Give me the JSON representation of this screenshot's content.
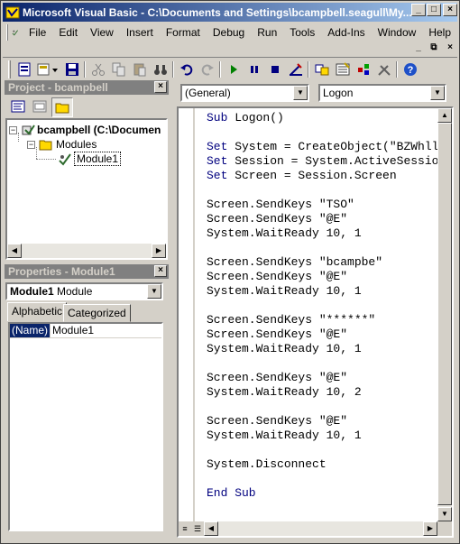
{
  "window": {
    "title": "Microsoft Visual Basic - C:\\Documents and Settings\\bcampbell.seagull\\My..."
  },
  "menu": {
    "items": [
      {
        "label": "File"
      },
      {
        "label": "Edit"
      },
      {
        "label": "View"
      },
      {
        "label": "Insert"
      },
      {
        "label": "Format"
      },
      {
        "label": "Debug"
      },
      {
        "label": "Run"
      },
      {
        "label": "Tools"
      },
      {
        "label": "Add-Ins"
      },
      {
        "label": "Window"
      },
      {
        "label": "Help"
      }
    ]
  },
  "project_panel": {
    "title": "Project - bcampbell",
    "root": "bcampbell (C:\\Documen",
    "folder": "Modules",
    "module": "Module1"
  },
  "properties_panel": {
    "title": "Properties - Module1",
    "object_bold": "Module1",
    "object_type": "Module",
    "tabs": [
      "Alphabetic",
      "Categorized"
    ],
    "property_name": "(Name)",
    "property_value": "Module1"
  },
  "code_window": {
    "object_combo": "(General)",
    "proc_combo": "Logon",
    "lines": [
      "Sub Logon()",
      "",
      "Set System = CreateObject(\"BZWhll",
      "Set Session = System.ActiveSessio",
      "Set Screen = Session.Screen",
      "",
      "Screen.SendKeys \"TSO\"",
      "Screen.SendKeys \"@E\"",
      "System.WaitReady 10, 1",
      "",
      "Screen.SendKeys \"bcampbe\"",
      "Screen.SendKeys \"@E\"",
      "System.WaitReady 10, 1",
      "",
      "Screen.SendKeys \"******\"",
      "Screen.SendKeys \"@E\"",
      "System.WaitReady 10, 1",
      "",
      "Screen.SendKeys \"@E\"",
      "System.WaitReady 10, 2",
      "",
      "Screen.SendKeys \"@E\"",
      "System.WaitReady 10, 1",
      "",
      "System.Disconnect",
      "",
      "End Sub"
    ]
  },
  "colors": {
    "title_start": "#0a246a",
    "title_end": "#a6caf0",
    "keyword": "#00007f",
    "panel_header": "#808080",
    "selection": "#0a246a"
  }
}
